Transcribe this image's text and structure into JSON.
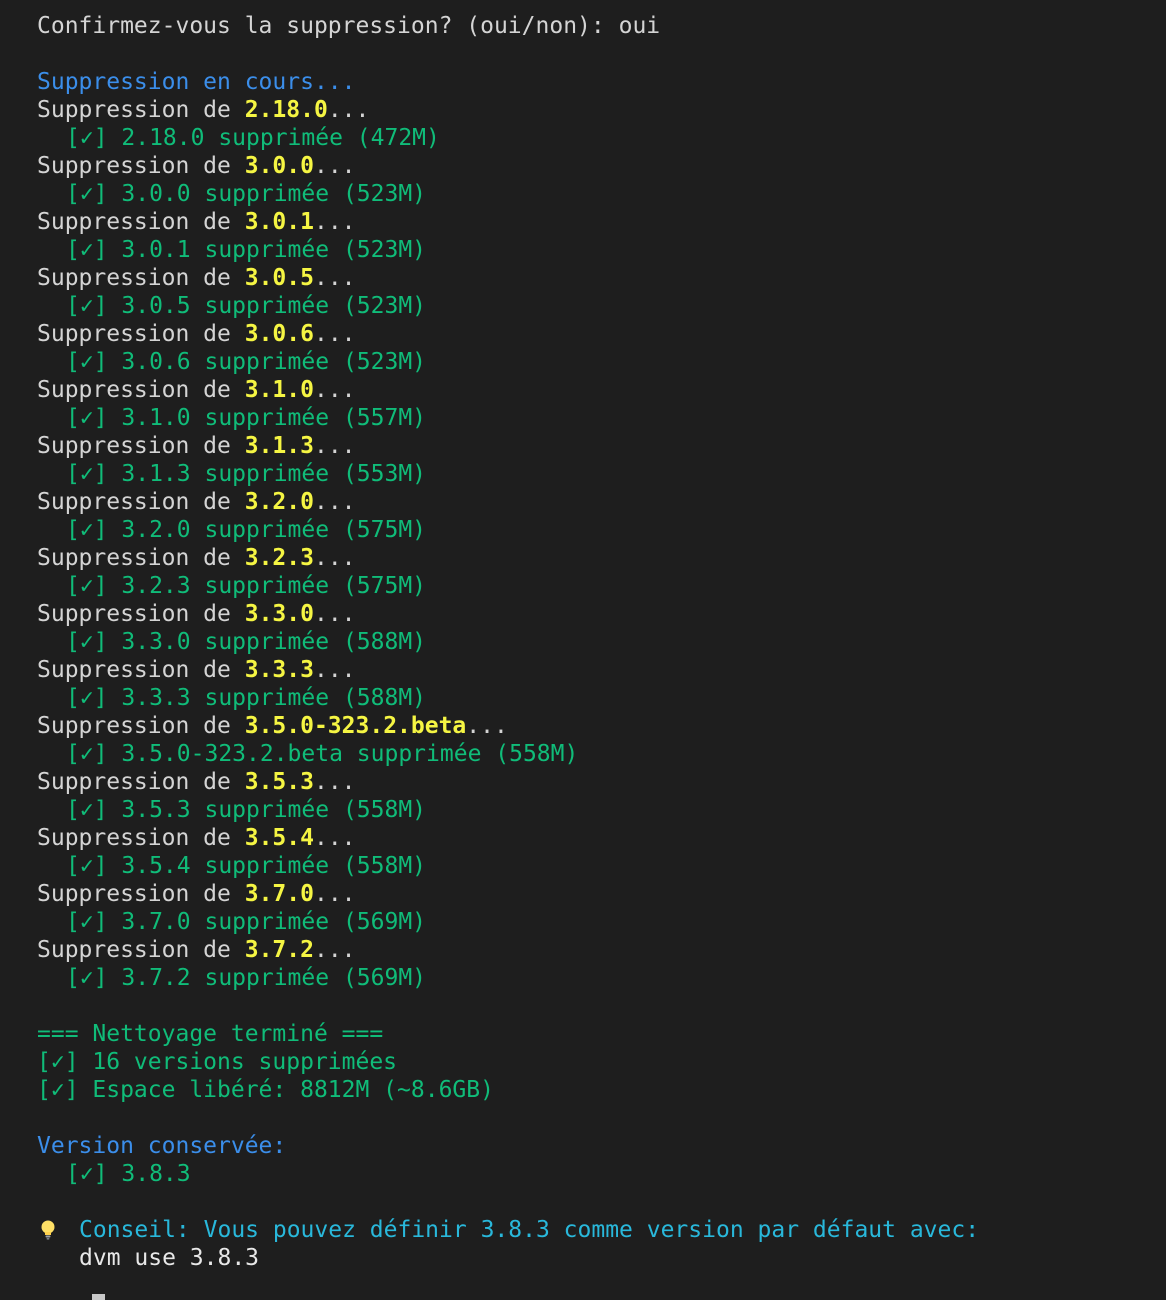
{
  "terminal": {
    "prompt": {
      "question": "Confirmez-vous la suppression? (oui/non): ",
      "answer": "oui"
    },
    "progress_header": "Suppression en cours...",
    "delete_prefix": "Suppression de ",
    "delete_suffix": "...",
    "deleted_items": [
      {
        "version": "2.18.0",
        "result": "[✓] 2.18.0 supprimée (472M)"
      },
      {
        "version": "3.0.0",
        "result": "[✓] 3.0.0 supprimée (523M)"
      },
      {
        "version": "3.0.1",
        "result": "[✓] 3.0.1 supprimée (523M)"
      },
      {
        "version": "3.0.5",
        "result": "[✓] 3.0.5 supprimée (523M)"
      },
      {
        "version": "3.0.6",
        "result": "[✓] 3.0.6 supprimée (523M)"
      },
      {
        "version": "3.1.0",
        "result": "[✓] 3.1.0 supprimée (557M)"
      },
      {
        "version": "3.1.3",
        "result": "[✓] 3.1.3 supprimée (553M)"
      },
      {
        "version": "3.2.0",
        "result": "[✓] 3.2.0 supprimée (575M)"
      },
      {
        "version": "3.2.3",
        "result": "[✓] 3.2.3 supprimée (575M)"
      },
      {
        "version": "3.3.0",
        "result": "[✓] 3.3.0 supprimée (588M)"
      },
      {
        "version": "3.3.3",
        "result": "[✓] 3.3.3 supprimée (588M)"
      },
      {
        "version": "3.5.0-323.2.beta",
        "result": "[✓] 3.5.0-323.2.beta supprimée (558M)"
      },
      {
        "version": "3.5.3",
        "result": "[✓] 3.5.3 supprimée (558M)"
      },
      {
        "version": "3.5.4",
        "result": "[✓] 3.5.4 supprimée (558M)"
      },
      {
        "version": "3.7.0",
        "result": "[✓] 3.7.0 supprimée (569M)"
      },
      {
        "version": "3.7.2",
        "result": "[✓] 3.7.2 supprimée (569M)"
      }
    ],
    "summary": {
      "title": "=== Nettoyage terminé ===",
      "count_line": "[✓] 16 versions supprimées",
      "space_line": "[✓] Espace libéré: 8812M (~8.6GB)"
    },
    "kept": {
      "title": "Version conservée:",
      "item": "[✓] 3.8.3"
    },
    "tip": {
      "icon": "lightbulb-icon",
      "text": "Conseil: Vous pouvez définir 3.8.3 comme version par défaut avec:",
      "command": "dvm use 3.8.3"
    },
    "colors": {
      "background": "#1e1e1e",
      "text": "#d4d4d4",
      "blue": "#3b8eea",
      "green": "#10bc79",
      "yellow": "#f5f543",
      "cyan": "#29b8db"
    }
  }
}
